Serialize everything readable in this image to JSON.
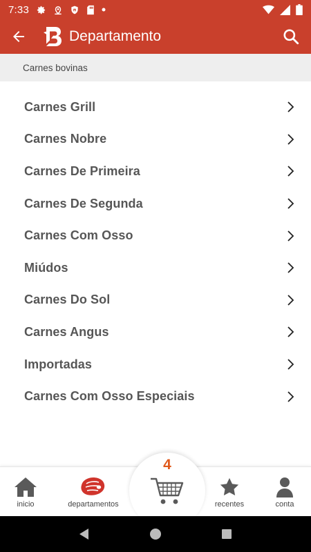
{
  "status_bar": {
    "time": "7:33",
    "icons": [
      "settings-icon",
      "location-icon",
      "shield-icon",
      "sd-card-icon",
      "dot-icon"
    ],
    "right_icons": [
      "wifi-icon",
      "signal-icon",
      "battery-icon"
    ]
  },
  "app_bar": {
    "title": "Departamento",
    "back_icon": "arrow-back-icon",
    "search_icon": "search-icon"
  },
  "section": {
    "title": "Carnes bovinas"
  },
  "categories": [
    {
      "label": "Carnes Grill"
    },
    {
      "label": "Carnes Nobre"
    },
    {
      "label": "Carnes De Primeira"
    },
    {
      "label": "Carnes De Segunda"
    },
    {
      "label": "Carnes Com Osso"
    },
    {
      "label": "Miúdos"
    },
    {
      "label": "Carnes Do Sol"
    },
    {
      "label": "Carnes Angus"
    },
    {
      "label": "Importadas"
    },
    {
      "label": "Carnes Com Osso Especiais"
    }
  ],
  "bottom_nav": {
    "home": "inicio",
    "departments": "departamentos",
    "recent": "recentes",
    "account": "conta"
  },
  "cart": {
    "count": "4"
  },
  "colors": {
    "primary": "#c9402c",
    "cart_count": "#e05a1c",
    "department_icon": "#d0342c",
    "nav_icon": "#5a5a5a"
  }
}
